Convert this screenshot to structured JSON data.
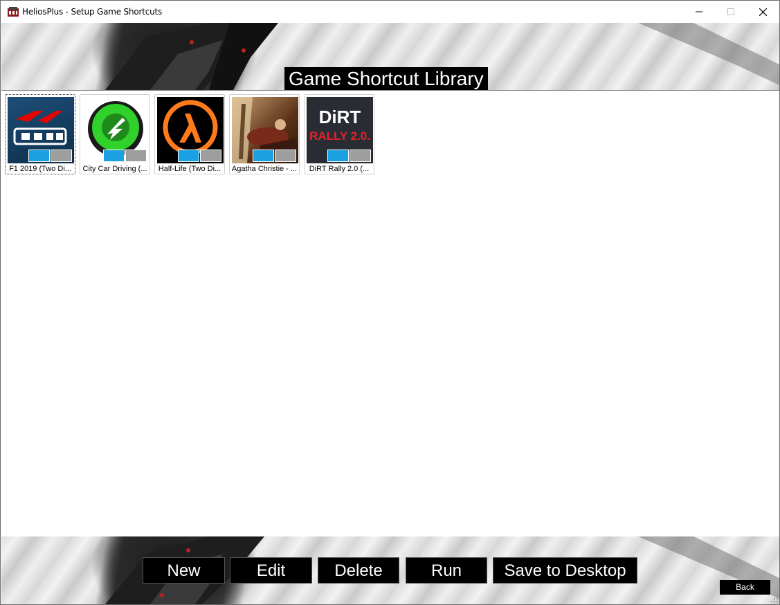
{
  "window": {
    "title": "HeliosPlus - Setup Game Shortcuts",
    "controls": [
      "minimize",
      "maximize",
      "close"
    ]
  },
  "header": {
    "title": "Game Shortcut Library"
  },
  "shortcuts": [
    {
      "label": "F1 2019 (Two Di...",
      "icon": "f1-2019-icon",
      "selected": true
    },
    {
      "label": "City Car Driving (...",
      "icon": "city-car-driving-icon",
      "selected": false
    },
    {
      "label": "Half-Life (Two Di...",
      "icon": "half-life-icon",
      "selected": false
    },
    {
      "label": "Agatha Christie - ...",
      "icon": "agatha-christie-icon",
      "selected": false
    },
    {
      "label": "DiRT Rally 2.0 (...",
      "icon": "dirt-rally-icon",
      "selected": false
    }
  ],
  "icon_text": {
    "dirt_line1": "DiRT",
    "dirt_line2": "RALLY 2.0."
  },
  "actions": {
    "new": "New",
    "edit": "Edit",
    "delete": "Delete",
    "run": "Run",
    "save_to_desktop": "Save to Desktop",
    "back": "Back"
  },
  "colors": {
    "display_primary": "#1ba1e2",
    "display_secondary": "#9e9e9e",
    "button_bg": "#000000",
    "button_text": "#ffffff"
  }
}
